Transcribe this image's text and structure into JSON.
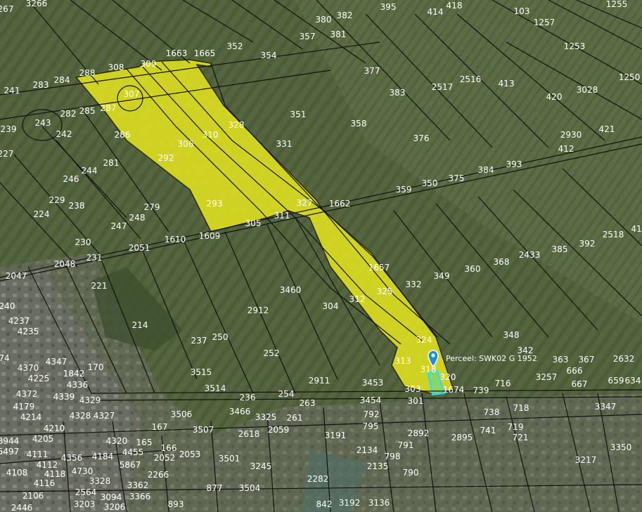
{
  "marker": {
    "label": "Perceel: SWK02 G 1952"
  },
  "parcel_labels": [
    "267",
    "3266",
    "395",
    "414",
    "418",
    "103",
    "1255",
    "1257",
    "1253",
    "380",
    "382",
    "381",
    "357",
    "352",
    "1663",
    "1665",
    "354",
    "377",
    "383",
    "2517",
    "2516",
    "413",
    "420",
    "3028",
    "1250",
    "288",
    "308",
    "309",
    "284",
    "283",
    "241",
    "307",
    "287",
    "285",
    "282",
    "243",
    "242",
    "239",
    "286",
    "306",
    "310",
    "328",
    "351",
    "358",
    "376",
    "331",
    "2930",
    "421",
    "412",
    "227",
    "292",
    "281",
    "244",
    "246",
    "229",
    "238",
    "224",
    "279",
    "247",
    "248",
    "293",
    "305",
    "311",
    "327",
    "1662",
    "359",
    "350",
    "375",
    "384",
    "393",
    "2518",
    "41",
    "230",
    "2051",
    "1610",
    "1609",
    "231",
    "2048",
    "2047",
    "221",
    "1657",
    "349",
    "360",
    "368",
    "2433",
    "385",
    "392",
    "332",
    "325",
    "312",
    "3460",
    "304",
    "240",
    "2912",
    "214",
    "4237",
    "4235",
    "237",
    "250",
    "252",
    "348",
    "342",
    "363",
    "367",
    "2632",
    "324",
    "313",
    "318",
    "320",
    "1674",
    "303",
    "739",
    "716",
    "3257",
    "666",
    "667",
    "659",
    "634",
    "74",
    "4370",
    "4225",
    "4347",
    "1842",
    "170",
    "4336",
    "4339",
    "4329",
    "4372",
    "4179",
    "4214",
    "4328",
    "4327",
    "2911",
    "3453",
    "3454",
    "301",
    "3515",
    "3514",
    "3466",
    "236",
    "254",
    "263",
    "3347",
    "792",
    "795",
    "738",
    "718",
    "741",
    "719",
    "721",
    "4210",
    "4205",
    "3944",
    "5497",
    "3506",
    "167",
    "3507",
    "2618",
    "3325",
    "261",
    "2059",
    "3191",
    "2134",
    "791",
    "2892",
    "2895",
    "3350",
    "4320",
    "165",
    "166",
    "4111",
    "4356",
    "4184",
    "4455",
    "2052",
    "2053",
    "3501",
    "3245",
    "2135",
    "798",
    "3217",
    "4112",
    "5867",
    "4108",
    "4118",
    "4730",
    "4116",
    "2266",
    "3328",
    "3362",
    "2282",
    "790",
    "2106",
    "2564",
    "3094",
    "3366",
    "877",
    "3504",
    "893",
    "842",
    "3192",
    "3136",
    "3203",
    "3206",
    "2446"
  ],
  "colors": {
    "selection_fill": "#e6e61e",
    "selection_stroke": "#3a3a00",
    "marker_fill": "#1e8fd6",
    "highlight_parcel": "#36d6c6",
    "parcel_line": "#111111"
  }
}
